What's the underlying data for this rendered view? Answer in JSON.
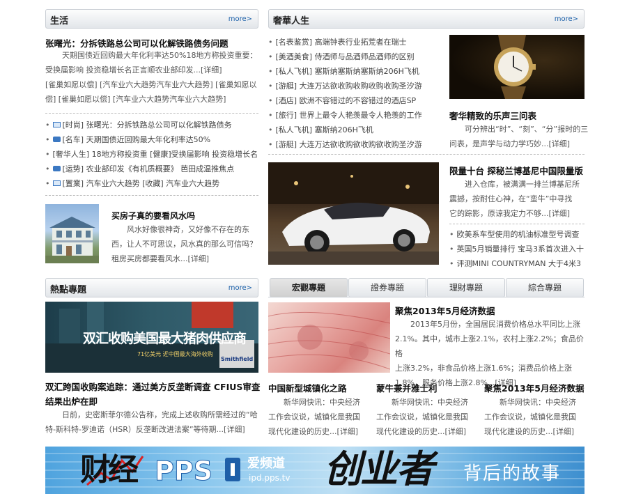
{
  "life": {
    "title": "生活",
    "more": "more>",
    "headline": "张曙光：分拆铁路总公司可以化解铁路债务问题",
    "summary": "天期国债近回购最大年化利率达50%18地方称投资重要：受换届影响 投资稳增长名正言顺农业部印发...[详细]",
    "summary_line1": "天期国债近回购最大年化利率达50%18地方称投资重要：",
    "summary_line2": "受换届影响 投资稳增长名正言顺农业部印发...[详细]",
    "tags_line1": "[雀巢如愿以偿] [汽车业六大趋势汽车业六大趋势]   [雀巢如愿以",
    "tags_line2": "偿] [雀巢如愿以偿] [汽车业六大趋势汽车业六大趋势]",
    "list": [
      {
        "icon": "mail-icon",
        "text": "[时尚] 张曙光：分拆铁路总公司可以化解铁路债务"
      },
      {
        "icon": "chat-icon",
        "text": "[名车] 天期国债近回购最大年化利率达50%"
      },
      {
        "icon": "none",
        "text": "[奢华人生] 18地方称投资重  [健康]受换届影响 投资稳增长名"
      },
      {
        "icon": "chat-icon",
        "text": "[运势] 农业部印发《有机质概要》 芭田成温推焦点"
      },
      {
        "icon": "mail-icon",
        "text": "[置業] 汽车业六大趋势  [收藏] 汽车业六大趋势"
      }
    ],
    "feature_title": "买房子真的要看风水吗",
    "feature_line1": "风水好像很神奇，又好像不存在的东",
    "feature_line2": "西，让人不可思议，风水真的那么可信吗？",
    "feature_line3": "租房买房都要看风水...[详细]"
  },
  "luxury": {
    "title": "奢華人生",
    "more": "more>",
    "list": [
      "[名表鉴赏] 高端钟表行业拓荒者在瑞士",
      "[美酒美食] 侍酒师与品酒师品酒师的区别",
      "[私人飞机] 塞斯纳塞斯纳塞斯纳206H飞机",
      "[游艇] 大连万达欲收购收购收购收购圣汐游",
      "[酒店] 欧洲不容错过的不容错过的酒店SP",
      "[旅行] 世界上最令人艳羡最令人艳羡的工作",
      "[私人飞机] 塞斯纳206H飞机",
      "[游艇] 大连万达欲收购欲收购欲收购圣汐游"
    ],
    "watch_title": "奢华精致的乐声三问表",
    "watch_line1": "可分辨出“时”、“刻”、“分”报时的三",
    "watch_line2": "问表，是声学与动力学巧妙...[详细]",
    "car_title": "限量十台 探秘兰博基尼中国限量版",
    "car_line1": "进入仓库，被满满一排兰博基尼所",
    "car_line2": "震撼，按耐住心神，在“蛮牛”中寻找",
    "car_line3": "它的踪影，原谅我定力不够...[详细]",
    "car_list": [
      "欧美系车型使用的机油标准型号调查",
      "英国5月销量排行 宝马3系首次进入十",
      "评测MINI COUNTRYMAN 大于4米3"
    ]
  },
  "hot": {
    "title": "熱點專題",
    "more": "more>",
    "banner_text": "双汇收购美国最大猪肉供应商",
    "banner_sub": "71亿美元 近中国最大海外收购",
    "banner_brand": "Smithfield",
    "headline_line1": "双汇跨国收购案追踪：通过美方反垄断调查 CFIUS审查",
    "headline_line2": "结果出炉在即",
    "body_line1": "日前，史密斯菲尔德公告称，完成上述收购所需经过的“哈",
    "body_line2": "特-斯科特-罗迪诺（HSR）反垄断改进法案”等待期...[详细]"
  },
  "tabs": [
    "宏觀專題",
    "證券專題",
    "理財專題",
    "綜合專題"
  ],
  "macro": {
    "title": "聚焦2013年5月经济数据",
    "line1": "2013年5月份，全国居民消费价格总水平同比上涨",
    "line2": "2.1%。其中，城市上涨2.1%，农村上涨2.2%；食品价格",
    "line3": "上涨3.2%，非食品价格上涨1.6%；消费品价格上涨",
    "line4": "1.8%，服务价格上涨2.8%...[详细]",
    "cols": [
      {
        "title": "中国新型城镇化之路",
        "line1": "新华网快讯：中央经济",
        "line2": "工作会议说，城镇化是我国",
        "line3": "现代化建设的历史...[详细]"
      },
      {
        "title": "蒙牛兼并雅士利",
        "line1": "新华网快讯：中央经济",
        "line2": "工作会议说，城镇化是我国",
        "line3": "现代化建设的历史...[详细]"
      },
      {
        "title": "聚焦2013年5月经济数据",
        "line1": "新华网快讯：中央经济",
        "line2": "工作会议说，城镇化是我国",
        "line3": "现代化建设的历史...[详细]"
      }
    ]
  },
  "ad": {
    "caijing": "财经",
    "pps": "PPS",
    "channel": "爱频道",
    "url": "ipd.pps.tv",
    "big": "创业者",
    "tail": "背后的故事"
  }
}
